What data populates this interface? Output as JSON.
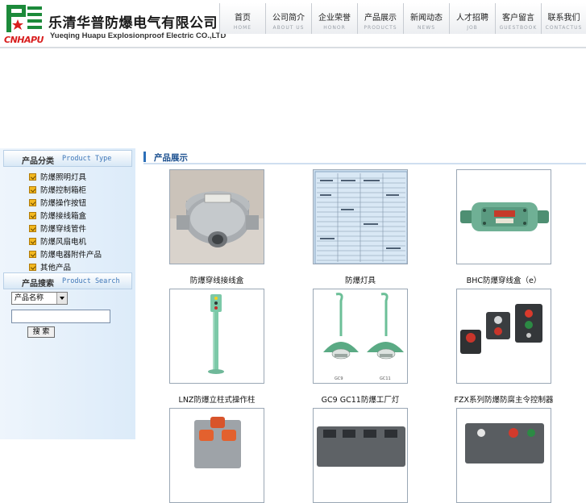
{
  "header": {
    "logo_text": "CNHAPU",
    "company_cn": "乐清华普防爆电气有限公司",
    "company_en": "Yueqing Huapu Explosionproof Electric CO.,LTD"
  },
  "nav": [
    {
      "cn": "首页",
      "en": "HOME"
    },
    {
      "cn": "公司简介",
      "en": "ABOUT US"
    },
    {
      "cn": "企业荣誉",
      "en": "HONOR"
    },
    {
      "cn": "产品展示",
      "en": "PRODUCTS"
    },
    {
      "cn": "新闻动态",
      "en": "NEWS"
    },
    {
      "cn": "人才招聘",
      "en": "JOB"
    },
    {
      "cn": "客户留言",
      "en": "GUESTBOOK"
    },
    {
      "cn": "联系我们",
      "en": "CONTACTUS"
    }
  ],
  "sidebar": {
    "category_title_cn": "产品分类",
    "category_title_en": "Product Type",
    "categories": [
      "防爆照明灯具",
      "防爆控制箱柜",
      "防爆操作按钮",
      "防爆接线箱盒",
      "防爆穿线管件",
      "防爆风扇电机",
      "防爆电器附件产品",
      "其他产品"
    ],
    "search_title_cn": "产品搜索",
    "search_title_en": "Product Search",
    "search_select_value": "产品名称",
    "search_input_value": "",
    "search_button_label": "搜 索"
  },
  "main": {
    "title": "产品展示",
    "products": [
      {
        "caption": "防爆穿线接线盒"
      },
      {
        "caption": "防爆灯具"
      },
      {
        "caption": "BHC防爆穿线盒（e）"
      },
      {
        "caption": "LNZ防爆立柱式操作柱"
      },
      {
        "caption": "GC9 GC11防爆工厂灯"
      },
      {
        "caption": "FZX系列防爆防腐主令控制器"
      },
      {
        "caption": ""
      },
      {
        "caption": ""
      },
      {
        "caption": ""
      }
    ]
  },
  "colors": {
    "brand_red": "#d81e1e",
    "brand_green": "#1c8a3a",
    "accent_blue": "#2c6fb8",
    "sidebar_bg": "#dcebf9"
  }
}
